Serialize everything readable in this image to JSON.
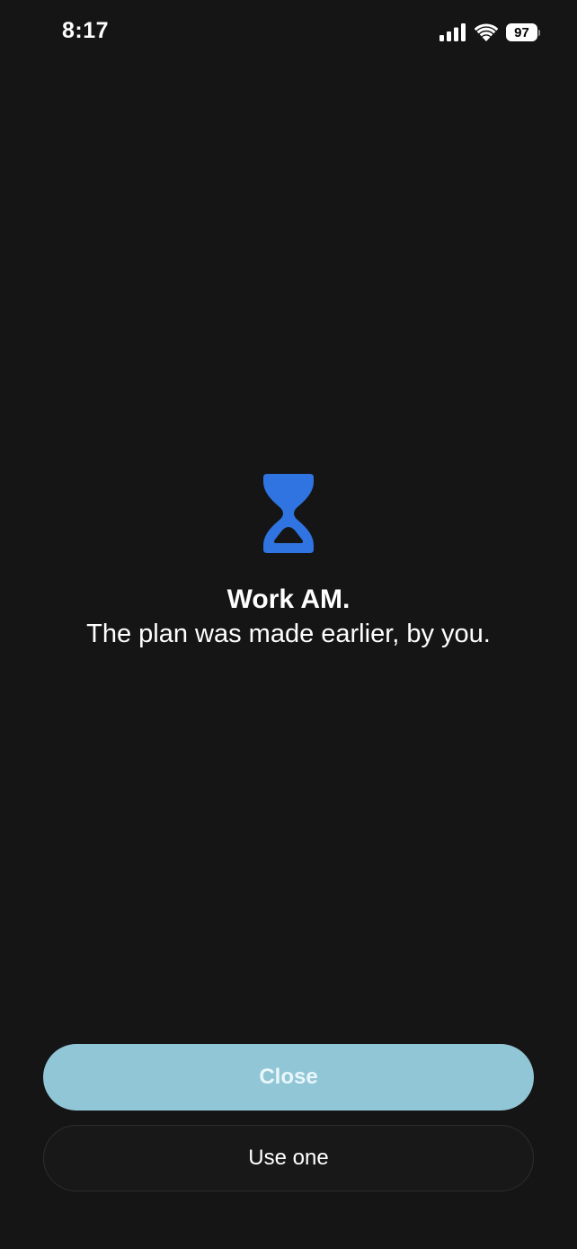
{
  "status_bar": {
    "time": "8:17",
    "battery_level": "97",
    "icons": [
      "cellular-signal-icon",
      "wifi-icon",
      "battery-icon"
    ]
  },
  "main": {
    "icon": "hourglass-icon",
    "icon_color": "#2f74e0",
    "title": "Work AM.",
    "subtitle": "The plan was made earlier, by you."
  },
  "actions": {
    "primary_label": "Close",
    "secondary_label": "Use one"
  },
  "colors": {
    "background": "#151515",
    "primary_button": "#91c6d7",
    "primary_button_text": "#e9f7fb",
    "secondary_button": "#181818"
  }
}
